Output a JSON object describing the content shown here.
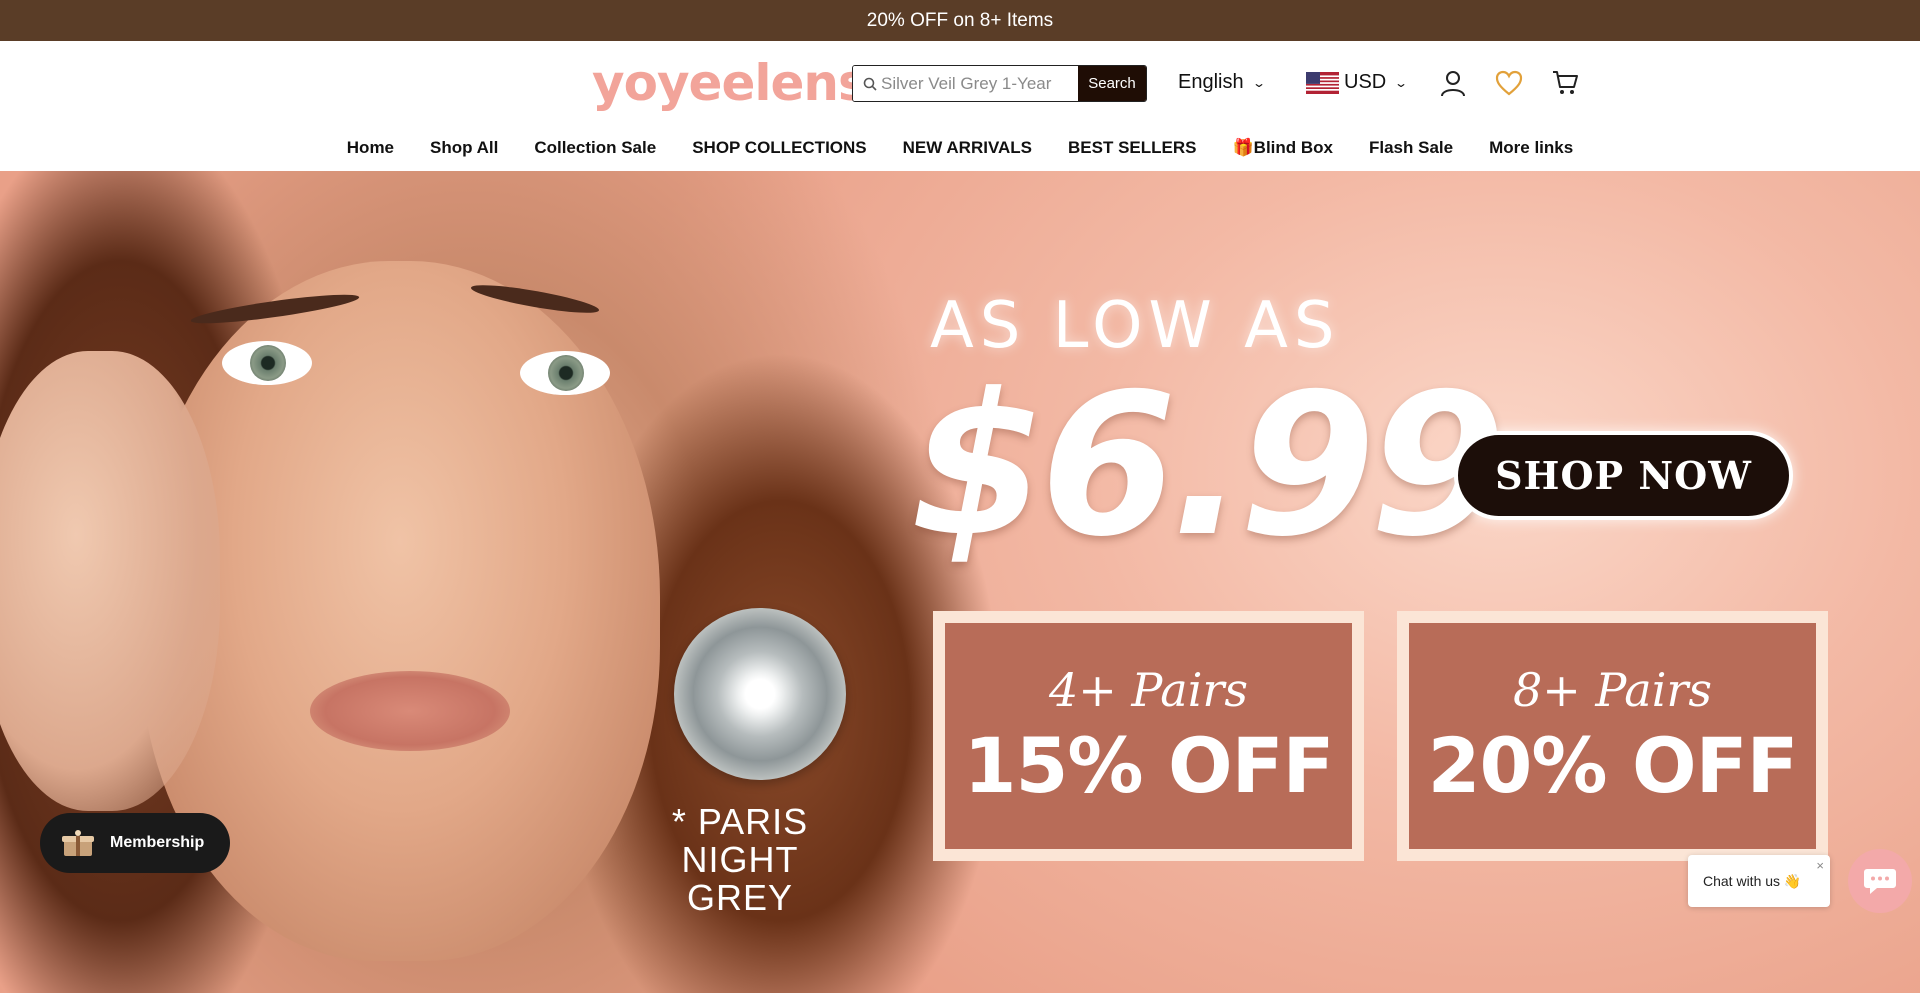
{
  "announcement": {
    "text": "20% OFF on 8+ Items"
  },
  "header": {
    "logo_text": "yoyeelens",
    "search": {
      "placeholder": "Silver Veil Grey 1-Year",
      "button_label": "Search"
    },
    "language": "English",
    "currency": "USD",
    "icons": [
      "account-icon",
      "heart-icon",
      "cart-icon"
    ]
  },
  "nav": {
    "items": [
      {
        "label": "Home"
      },
      {
        "label": "Shop All"
      },
      {
        "label": "Collection Sale"
      },
      {
        "label": "SHOP COLLECTIONS"
      },
      {
        "label": "NEW ARRIVALS"
      },
      {
        "label": "BEST SELLERS"
      },
      {
        "label": "🎁Blind Box"
      },
      {
        "label": "Flash Sale"
      },
      {
        "label": "More links"
      }
    ]
  },
  "hero": {
    "headline": "AS LOW AS",
    "price": "$6.99",
    "cta": "SHOP NOW",
    "lens_caption_line1": "* PARIS NIGHT",
    "lens_caption_line2": "GREY",
    "promos": [
      {
        "pairs": "4+ Pairs",
        "discount": "15% OFF"
      },
      {
        "pairs": "8+ Pairs",
        "discount": "20% OFF"
      }
    ]
  },
  "widgets": {
    "membership_label": "Membership",
    "chat_text": "Chat with us 👋",
    "chat_close": "×"
  },
  "colors": {
    "announcement_bg": "#5a3d27",
    "logo": "#f2a49a",
    "search_button": "#1f0d05",
    "wishlist_icon": "#e2a13a",
    "promo_box": "#b86c58",
    "chat_launcher": "#f3a9a9"
  }
}
